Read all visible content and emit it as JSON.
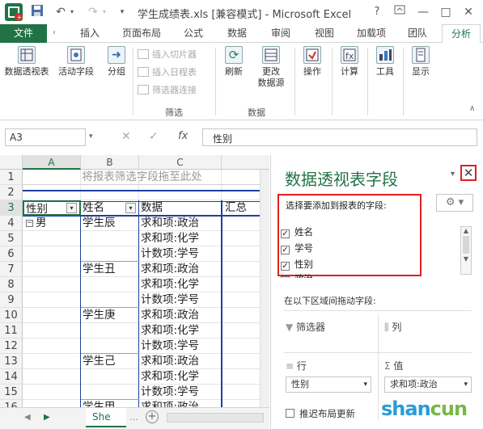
{
  "titlebar": {
    "title": "学生成绩表.xls  [兼容模式] - Microsoft Excel",
    "help": "?",
    "minimize": "—",
    "restore": "□",
    "close": "✕"
  },
  "tabs": [
    "文件",
    "插入",
    "页面布局",
    "公式",
    "数据",
    "审阅",
    "视图",
    "加载项",
    "团队",
    "分析"
  ],
  "ribbon": {
    "pivot_table": "数据透视表",
    "active_field": "活动字段",
    "group": "分组",
    "insert_slicer": "插入切片器",
    "insert_timeline": "插入日程表",
    "filter_connections": "筛选器连接",
    "filter_group": "筛选",
    "refresh": "刷新",
    "change_source_1": "更改",
    "change_source_2": "数据源",
    "data_group": "数据",
    "actions": "操作",
    "calculations": "计算",
    "tools": "工具",
    "show": "显示"
  },
  "formula_bar": {
    "name_box": "A3",
    "value": "性别",
    "fx": "fx"
  },
  "sheet": {
    "columns": [
      "A",
      "B",
      "C"
    ],
    "col_d_partial": "汇总",
    "rows": [
      "1",
      "2",
      "3",
      "4",
      "5",
      "6",
      "7",
      "8",
      "9",
      "10",
      "11",
      "12",
      "13",
      "14",
      "15",
      "16"
    ],
    "drop_hint": "将报表筛选字段拖至此处",
    "header": {
      "a": "性别",
      "b": "姓名",
      "c": "数据"
    },
    "gender": "男",
    "students": [
      "学生辰",
      "学生丑",
      "学生庚",
      "学生己",
      "学生甲"
    ],
    "measures": [
      "求和项:政治",
      "求和项:化学",
      "计数项:学号"
    ],
    "tab_name": "She"
  },
  "pane": {
    "title": "数据透视表字段",
    "prompt": "选择要添加到报表的字段:",
    "fields": [
      {
        "name": "姓名",
        "checked": true
      },
      {
        "name": "学号",
        "checked": true
      },
      {
        "name": "性别",
        "checked": true
      },
      {
        "name": "政治",
        "checked": true
      }
    ],
    "drag_hint": "在以下区域间拖动字段:",
    "filters": "筛选器",
    "columns": "列",
    "rows": "行",
    "values": "值",
    "rows_item": "性别",
    "values_item": "求和项:政治",
    "defer": "推迟布局更新",
    "watermark": "shancun"
  }
}
